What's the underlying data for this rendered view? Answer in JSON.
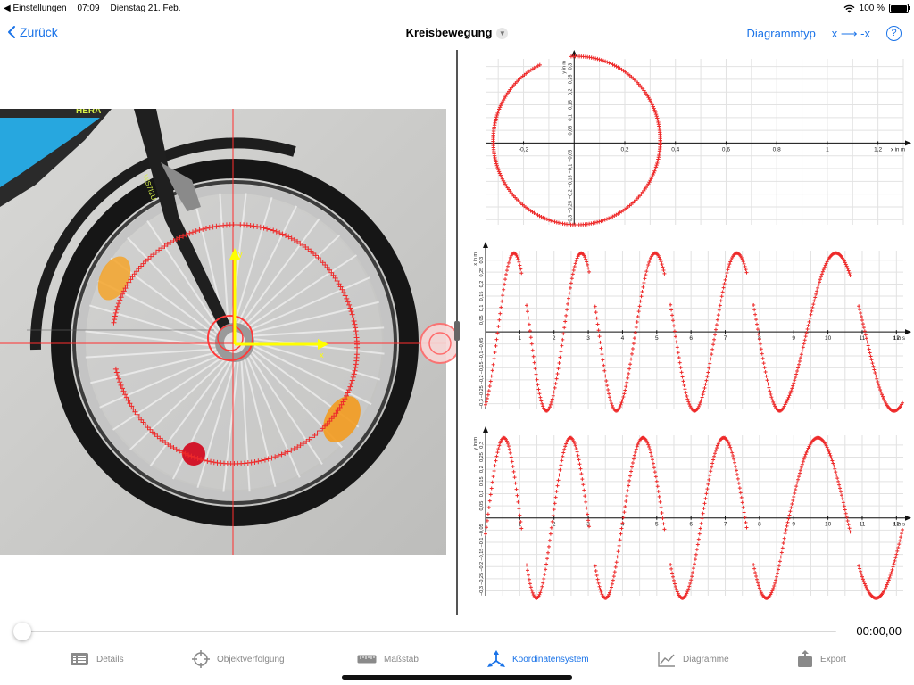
{
  "status": {
    "back_app": "Einstellungen",
    "time": "07:09",
    "date": "Dienstag 21. Feb.",
    "battery": "100 %",
    "battery_level": 1.0
  },
  "nav": {
    "back": "Zurück",
    "title": "Kreisbewegung",
    "diagram_type": "Diagrammtyp",
    "flip": "x ⟶ -x",
    "help": "?"
  },
  "photo": {
    "origin_axis_x": "x",
    "origin_axis_y": "y",
    "bike_label": "HERA",
    "fork_label": "WS7I2U"
  },
  "playback": {
    "time": "00:00,00",
    "position": 0.0
  },
  "tabs": [
    {
      "label": "Details",
      "icon": "list-icon",
      "active": false
    },
    {
      "label": "Objektverfolgung",
      "icon": "crosshair-icon",
      "active": false
    },
    {
      "label": "Maßstab",
      "icon": "ruler-icon",
      "active": false
    },
    {
      "label": "Koordinatensystem",
      "icon": "axes-icon",
      "active": true
    },
    {
      "label": "Diagramme",
      "icon": "line-chart-icon",
      "active": false
    },
    {
      "label": "Export",
      "icon": "share-icon",
      "active": false
    }
  ],
  "colors": {
    "accent": "#1a73e8",
    "trace": "#ee2a2a",
    "axis_overlay": "#ffff00"
  },
  "chart_data": [
    {
      "type": "scatter",
      "xlabel": "x in m",
      "ylabel": "y in m",
      "xlim": [
        -0.35,
        1.3
      ],
      "ylim": [
        -0.32,
        0.33
      ],
      "x_ticks": [
        "-0,2",
        "0,2",
        "0,4",
        "0,6",
        "0,8",
        "1",
        "1,2"
      ],
      "x_tick_values": [
        -0.2,
        0.2,
        0.4,
        0.6,
        0.8,
        1.0,
        1.2
      ],
      "y_ticks": [
        "0,3",
        "0,25",
        "0,2",
        "0,15",
        "0,1",
        "0,05",
        "−0,05",
        "−0,1",
        "−0,15",
        "−0,2",
        "−0,25",
        "−0,3"
      ],
      "y_tick_values": [
        0.3,
        0.25,
        0.2,
        0.15,
        0.1,
        0.05,
        -0.05,
        -0.1,
        -0.15,
        -0.2,
        -0.25,
        -0.3
      ],
      "trace": {
        "center": [
          0.01,
          0.01
        ],
        "radius": 0.33,
        "gap_angle_start": 95,
        "gap_angle_end": 116
      }
    },
    {
      "type": "line",
      "xlabel": "t in s",
      "ylabel": "x in m",
      "xlim": [
        0,
        12.2
      ],
      "ylim": [
        -0.32,
        0.34
      ],
      "x_ticks": [
        "1",
        "2",
        "3",
        "4",
        "5",
        "6",
        "7",
        "8",
        "9",
        "10",
        "11",
        "12"
      ],
      "x_tick_values": [
        1,
        2,
        3,
        4,
        5,
        6,
        7,
        8,
        9,
        10,
        11,
        12
      ],
      "y_ticks": [
        "0,3",
        "0,25",
        "0,2",
        "0,15",
        "0,1",
        "0,05",
        "−0,05",
        "−0,1",
        "−0,15",
        "−0,2",
        "−0,25",
        "−0,3"
      ],
      "y_tick_values": [
        0.3,
        0.25,
        0.2,
        0.15,
        0.1,
        0.05,
        -0.05,
        -0.1,
        -0.15,
        -0.2,
        -0.25,
        -0.3
      ],
      "series": [
        {
          "amplitude": 0.33,
          "periods_s": [
            1.9,
            2.05,
            2.3,
            2.5,
            3.4
          ],
          "phase": "cos",
          "start": -0.05
        }
      ]
    },
    {
      "type": "line",
      "xlabel": "t in s",
      "ylabel": "y in m",
      "xlim": [
        0,
        12.2
      ],
      "ylim": [
        -0.32,
        0.34
      ],
      "x_ticks": [
        "1",
        "2",
        "3",
        "4",
        "5",
        "6",
        "7",
        "8",
        "9",
        "10",
        "11",
        "12"
      ],
      "x_tick_values": [
        1,
        2,
        3,
        4,
        5,
        6,
        7,
        8,
        9,
        10,
        11,
        12
      ],
      "y_ticks": [
        "0,3",
        "0,25",
        "0,2",
        "0,15",
        "0,1",
        "0,05",
        "−0,05",
        "−0,1",
        "−0,15",
        "−0,2",
        "−0,25",
        "−0,3"
      ],
      "y_tick_values": [
        0.3,
        0.25,
        0.2,
        0.15,
        0.1,
        0.05,
        -0.05,
        -0.1,
        -0.15,
        -0.2,
        -0.25,
        -0.3
      ],
      "series": [
        {
          "amplitude": 0.33,
          "periods_s": [
            1.9,
            2.05,
            2.3,
            2.5,
            3.4
          ],
          "phase": "sin"
        }
      ]
    }
  ]
}
